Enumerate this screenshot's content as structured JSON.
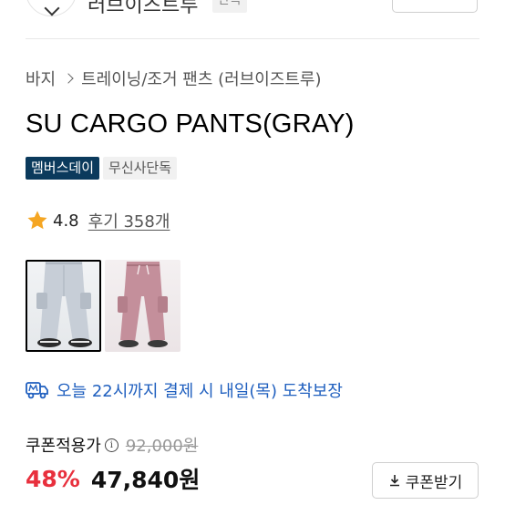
{
  "store": {
    "name": "러브이즈트루",
    "badge": "단독"
  },
  "breadcrumb": {
    "category": "바지",
    "subcategory": "트레이닝/조거 팬츠 (러브이즈트루)"
  },
  "product": {
    "title": "SU CARGO PANTS(GRAY)",
    "tags": [
      "멤버스데이",
      "무신사단독"
    ]
  },
  "rating": {
    "score": "4.8",
    "reviews": "후기 358개",
    "icon": "star-icon",
    "star_color": "#f5a623"
  },
  "thumbnails": [
    {
      "name": "gray",
      "color": "#c9d0d8",
      "selected": true
    },
    {
      "name": "pink",
      "color": "#c8939e",
      "selected": false
    }
  ],
  "delivery": {
    "text": "오늘 22시까지 결제 시 내일(목) 도착보장",
    "icon": "delivery-truck-icon",
    "color": "#1f5fbf"
  },
  "price": {
    "label": "쿠폰적용가",
    "original": "92,000원",
    "discount": "48%",
    "final": "47,840원",
    "discount_color": "#e8303d"
  },
  "coupon_button": {
    "label": "쿠폰받기"
  }
}
